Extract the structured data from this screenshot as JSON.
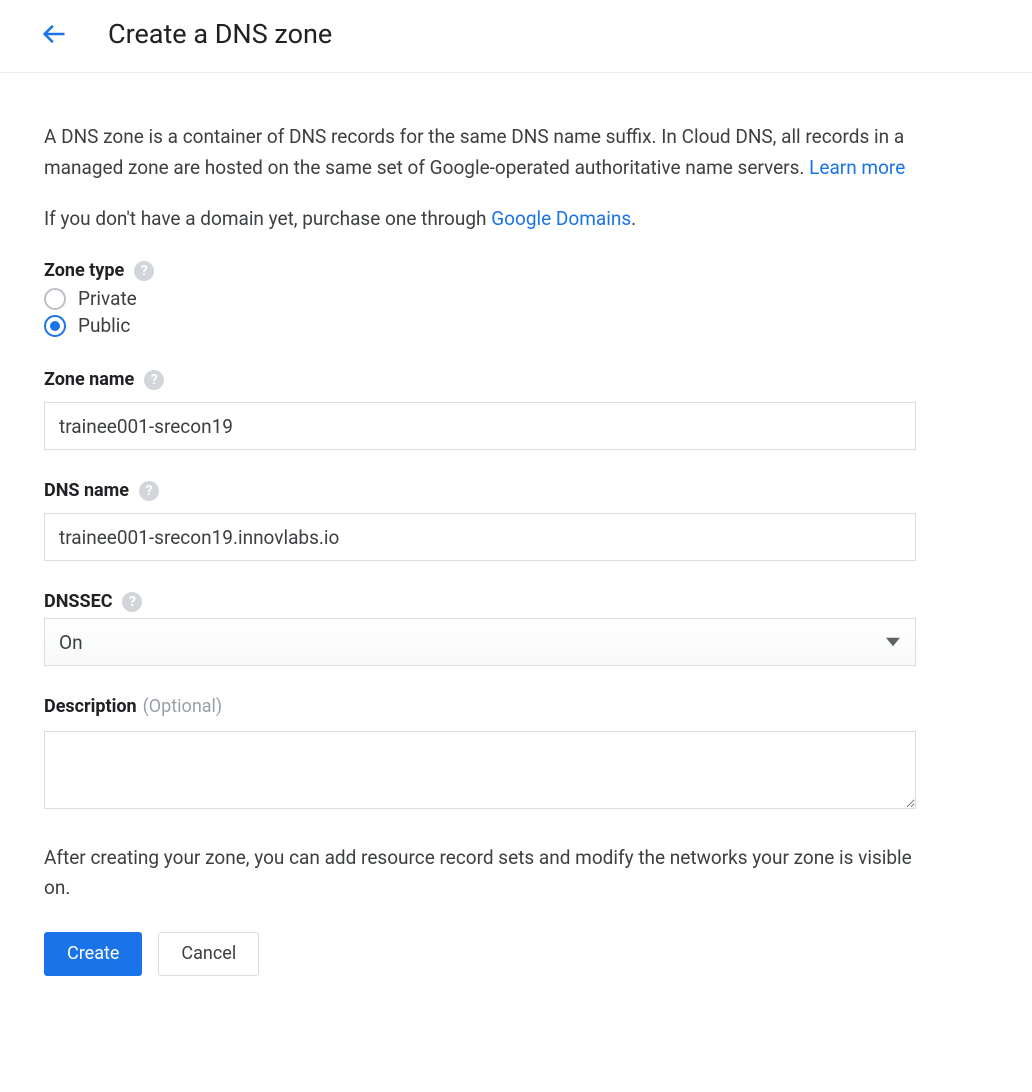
{
  "header": {
    "title": "Create a DNS zone"
  },
  "intro": {
    "text_before_link": "A DNS zone is a container of DNS records for the same DNS name suffix. In Cloud DNS, all records in a managed zone are hosted on the same set of Google-operated authoritative name servers. ",
    "learn_more": "Learn more"
  },
  "domain_note": {
    "text_before_link": "If you don't have a domain yet, purchase one through ",
    "link_text": "Google Domains",
    "text_after_link": "."
  },
  "zone_type": {
    "label": "Zone type",
    "options": {
      "private": "Private",
      "public": "Public"
    },
    "selected": "public"
  },
  "zone_name": {
    "label": "Zone name",
    "value": "trainee001-srecon19"
  },
  "dns_name": {
    "label": "DNS name",
    "value": "trainee001-srecon19.innovlabs.io"
  },
  "dnssec": {
    "label": "DNSSEC",
    "selected": "On"
  },
  "description": {
    "label": "Description",
    "optional_text": "(Optional)",
    "value": ""
  },
  "post_note": "After creating your zone, you can add resource record sets and modify the networks your zone is visible on.",
  "buttons": {
    "create": "Create",
    "cancel": "Cancel"
  }
}
